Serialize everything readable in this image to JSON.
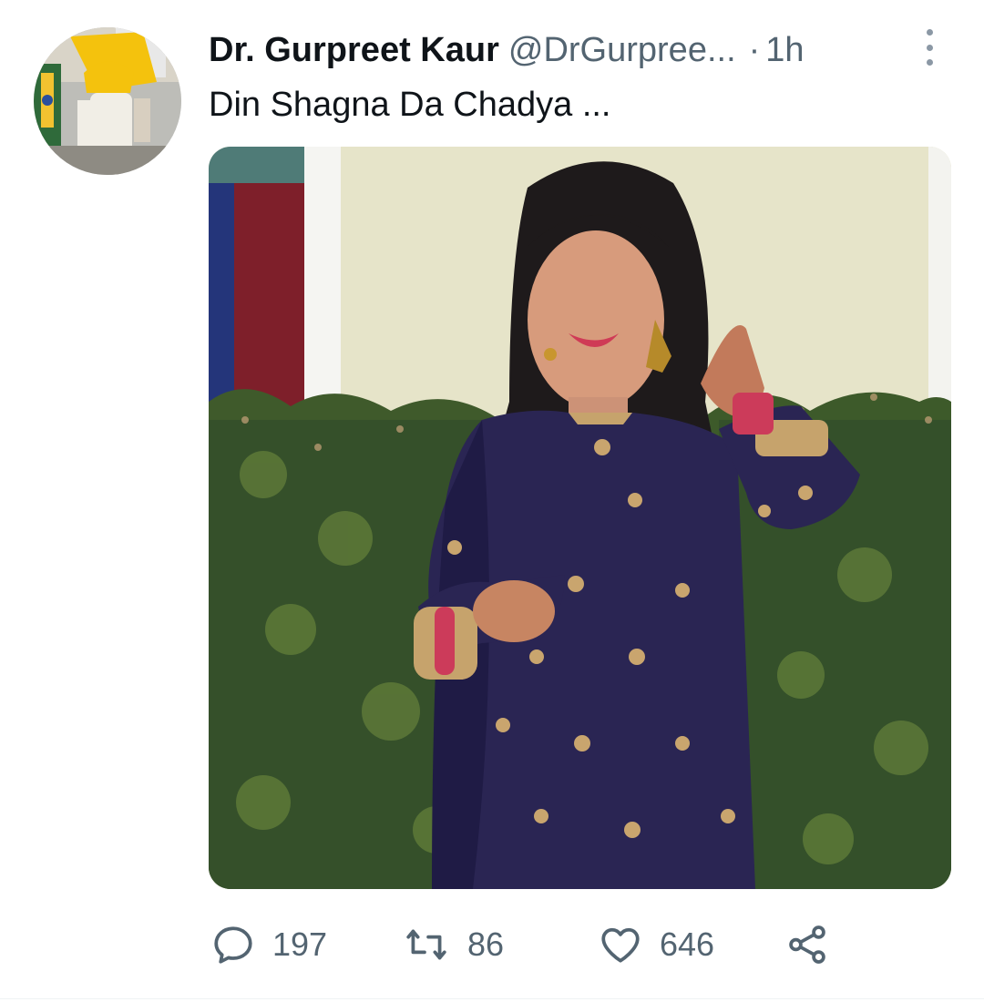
{
  "tweet": {
    "author": {
      "display_name": "Dr. Gurpreet Kaur",
      "handle": "@DrGurpree...",
      "avatar_icon": "profile-photo"
    },
    "separator": "·",
    "timestamp": "1h",
    "text": "Din Shagna Da Chadya ...",
    "media": {
      "icon": "photo"
    },
    "actions": {
      "reply": {
        "icon": "reply-icon",
        "count": "197"
      },
      "retweet": {
        "icon": "retweet-icon",
        "count": "86"
      },
      "like": {
        "icon": "heart-icon",
        "count": "646"
      },
      "share": {
        "icon": "share-icon"
      }
    }
  },
  "colors": {
    "text_primary": "#0f1419",
    "text_secondary": "#536471",
    "icon_gray": "#536471"
  }
}
